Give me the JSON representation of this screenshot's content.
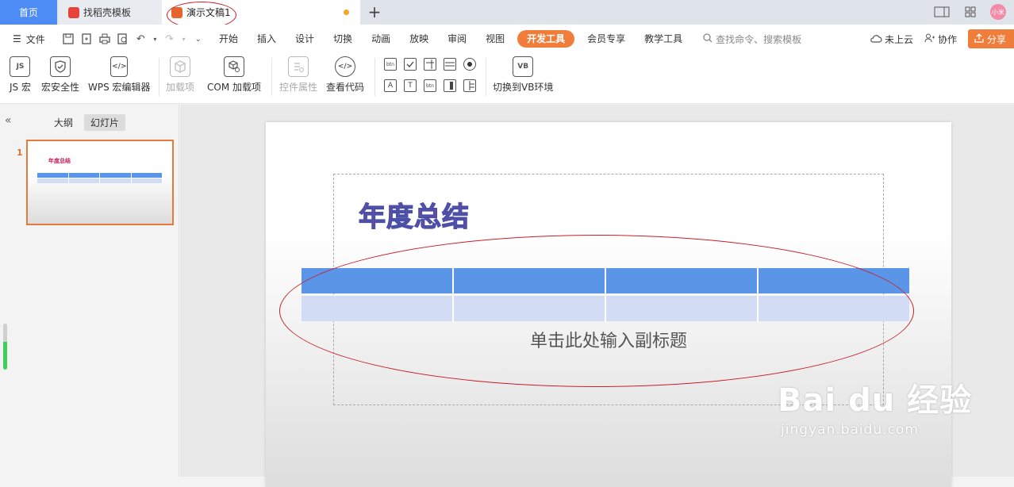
{
  "tabs": {
    "home": "首页",
    "template": "找稻壳模板",
    "document": "演示文稿1",
    "add": "+"
  },
  "tabbar_right": {
    "avatar_text": "小米"
  },
  "menu": {
    "file": "文件",
    "tabs": [
      "开始",
      "插入",
      "设计",
      "切换",
      "动画",
      "放映",
      "审阅",
      "视图",
      "开发工具",
      "会员专享",
      "教学工具"
    ],
    "active_tab": "开发工具",
    "search_placeholder": "查找命令、搜索模板",
    "cloud": "未上云",
    "collab": "协作",
    "share": "分享"
  },
  "ribbon": {
    "js_macro": "JS 宏",
    "macro_security": "宏安全性",
    "wps_macro_editor": "WPS 宏编辑器",
    "addins": "加载项",
    "com_addins": "COM 加载项",
    "control_properties": "控件属性",
    "view_code": "查看代码",
    "switch_vb": "切换到VB环境",
    "js_icon_text": "JS",
    "vb_icon_text": "VB",
    "controls_row1": [
      "btn",
      "",
      "",
      "",
      ""
    ],
    "controls_row2": [
      "A",
      "T",
      "btn",
      "",
      ""
    ]
  },
  "left_panel": {
    "outline_tab": "大纲",
    "slides_tab": "幻灯片",
    "slide_number": "1",
    "thumb_title": "年度总结"
  },
  "slide": {
    "title": "年度总结",
    "subtitle": "单击此处输入副标题",
    "table": {
      "columns": 4,
      "rows": 2
    }
  },
  "watermark": {
    "main": "Bai du 经验",
    "sub": "jingyan.baidu.com"
  },
  "colors": {
    "home_tab": "#4d8cf5",
    "accent": "#f17d3a",
    "table_header": "#5b95e8",
    "table_body": "#d2dcf5",
    "title_fill": "#d63a7a",
    "title_stroke": "#4a4fa8",
    "annotation": "#c8202a"
  }
}
